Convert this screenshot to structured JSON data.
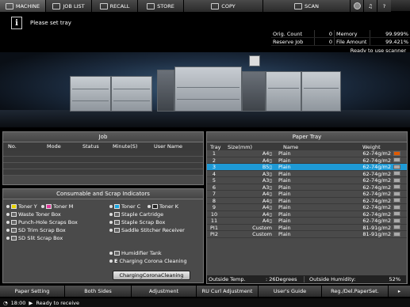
{
  "tabs": [
    {
      "label": "MACHINE",
      "icon": "machine-icon"
    },
    {
      "label": "JOB LIST",
      "icon": "job-list-icon"
    },
    {
      "label": "RECALL",
      "icon": "recall-icon"
    },
    {
      "label": "STORE",
      "icon": "store-icon"
    },
    {
      "label": "COPY",
      "icon": "copy-icon"
    },
    {
      "label": "SCAN",
      "icon": "scan-icon"
    }
  ],
  "message": "Please set tray",
  "status": {
    "orig_count_label": "Orig. Count",
    "orig_count": "0",
    "memory_label": "Memory",
    "memory": "99.999%",
    "reserve_label": "Reserve Job",
    "reserve": "0",
    "file_amount_label": "File Amount",
    "file_amount": "99.421%",
    "ready_scanner": "Ready to use scanner"
  },
  "job": {
    "title": "Job",
    "columns": [
      "No.",
      "Mode",
      "Status",
      "Minute(S)",
      "User Name"
    ]
  },
  "consumables": {
    "title": "Consumable and Scrap Indicators",
    "left": [
      "Toner Y",
      "Toner M",
      "Waste Toner Box",
      "Punch-Hole Scraps Box",
      "SD Trim Scrap Box",
      "SD Slit Scrap Box"
    ],
    "right": [
      "Toner C",
      "Toner K",
      "Staple Cartridge",
      "Staple Scrap Box",
      "Saddle Stitcher Receiver",
      "Humidifier Tank",
      "Charging Corona Cleaning"
    ],
    "button": "ChargingCoronaCleaning"
  },
  "paper_tray": {
    "title": "Paper Tray",
    "columns": [
      "Tray",
      "Size(mm)",
      "Name",
      "Weight"
    ],
    "rows": [
      {
        "tray": "1",
        "size": "A4▯",
        "name": "Plain",
        "weight": "62-74g/m2"
      },
      {
        "tray": "2",
        "size": "A4▯",
        "name": "Plain",
        "weight": "62-74g/m2"
      },
      {
        "tray": "3",
        "size": "B5▯",
        "name": "Plain",
        "weight": "62-74g/m2"
      },
      {
        "tray": "4",
        "size": "A3▯",
        "name": "Plain",
        "weight": "62-74g/m2"
      },
      {
        "tray": "5",
        "size": "A3▯",
        "name": "Plain",
        "weight": "62-74g/m2"
      },
      {
        "tray": "6",
        "size": "A3▯",
        "name": "Plain",
        "weight": "62-74g/m2"
      },
      {
        "tray": "7",
        "size": "A4▯",
        "name": "Plain",
        "weight": "62-74g/m2"
      },
      {
        "tray": "8",
        "size": "A4▯",
        "name": "Plain",
        "weight": "62-74g/m2"
      },
      {
        "tray": "9",
        "size": "A4▯",
        "name": "Plain",
        "weight": "62-74g/m2"
      },
      {
        "tray": "10",
        "size": "A4▯",
        "name": "Plain",
        "weight": "62-74g/m2"
      },
      {
        "tray": "11",
        "size": "A4▯",
        "name": "Plain",
        "weight": "62-74g/m2"
      },
      {
        "tray": "PI1",
        "size": "Custom",
        "name": "Plain",
        "weight": "81-91g/m2"
      },
      {
        "tray": "PI2",
        "size": "Custom",
        "name": "Plain",
        "weight": "81-91g/m2"
      }
    ],
    "selected_index": 2,
    "outside_temp_label": "Outside Temp.",
    "outside_temp": ": 26Degrees",
    "outside_humidity_label": "Outside Humidity:",
    "outside_humidity": "52%"
  },
  "bottom": [
    "Paper Setting",
    "Both Sides",
    "Adjustment",
    "RU Curl Adjustment",
    "User's Guide",
    "Reg./Del.PaperSet."
  ],
  "status_line": {
    "time": "18:00",
    "text": "Ready to receive"
  }
}
